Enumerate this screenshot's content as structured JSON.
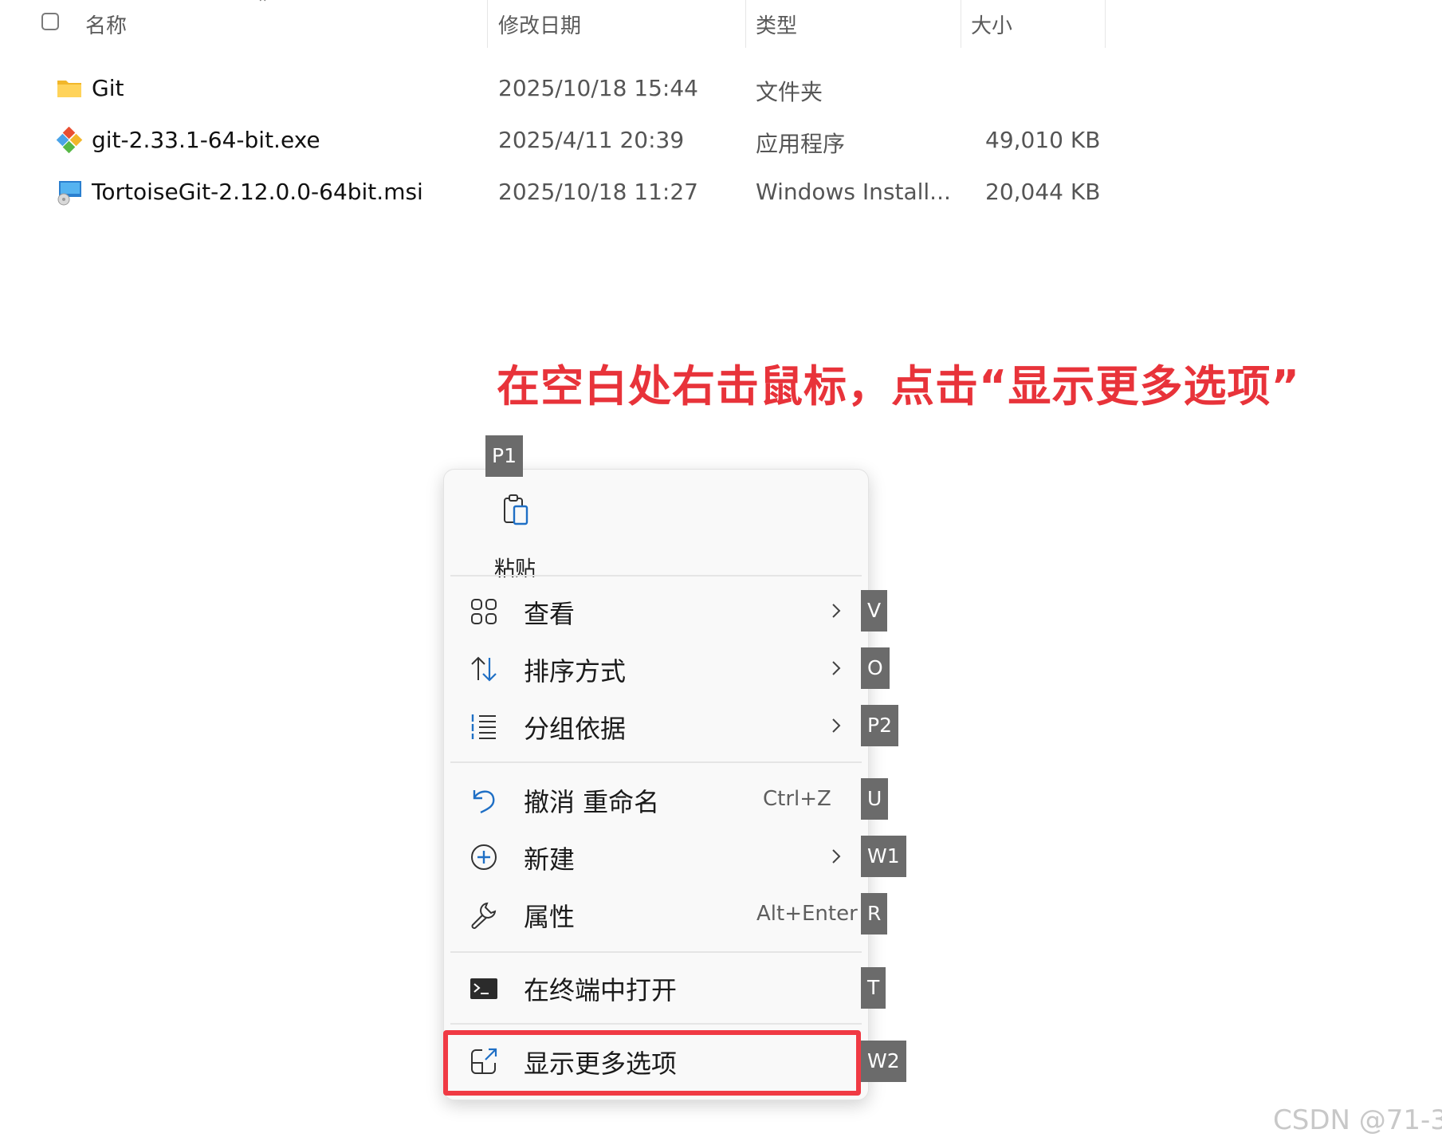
{
  "file_list": {
    "columns": {
      "name": "名称",
      "modified": "修改日期",
      "type": "类型",
      "size": "大小"
    },
    "rows": [
      {
        "name": "Git",
        "modified": "2025/10/18 15:44",
        "type": "文件夹",
        "size": "",
        "icon": "folder-icon"
      },
      {
        "name": "git-2.33.1-64-bit.exe",
        "modified": "2025/4/11 20:39",
        "type": "应用程序",
        "size": "49,010 KB",
        "icon": "git-exe-icon"
      },
      {
        "name": "TortoiseGit-2.12.0.0-64bit.msi",
        "modified": "2025/10/18 11:27",
        "type": "Windows Install...",
        "size": "20,044 KB",
        "icon": "msi-installer-icon"
      }
    ]
  },
  "annotation": "在空白处右击鼠标，点击“显示更多选项”",
  "context_menu": {
    "paste": {
      "label": "粘贴",
      "key": "P1",
      "icon": "paste-icon"
    },
    "items": [
      {
        "label": "查看",
        "key": "V",
        "icon": "grid-view-icon",
        "submenu": true
      },
      {
        "label": "排序方式",
        "key": "O",
        "icon": "sort-icon",
        "submenu": true
      },
      {
        "label": "分组依据",
        "key": "P2",
        "icon": "group-list-icon",
        "submenu": true
      },
      {
        "label": "撤消 重命名",
        "shortcut": "Ctrl+Z",
        "key": "U",
        "icon": "undo-icon"
      },
      {
        "label": "新建",
        "key": "W1",
        "icon": "new-plus-icon",
        "submenu": true
      },
      {
        "label": "属性",
        "shortcut": "Alt+Enter",
        "key": "R",
        "icon": "wrench-icon"
      },
      {
        "label": "在终端中打开",
        "key": "T",
        "icon": "terminal-icon"
      },
      {
        "label": "显示更多选项",
        "key": "W2",
        "icon": "open-external-icon"
      }
    ]
  },
  "colors": {
    "annotation": "#e8333a",
    "highlight_border": "#f03a44",
    "key_tag": "#6b6b6b",
    "icon_blue": "#1f6fc5"
  },
  "watermark": "CSDN @71-3"
}
